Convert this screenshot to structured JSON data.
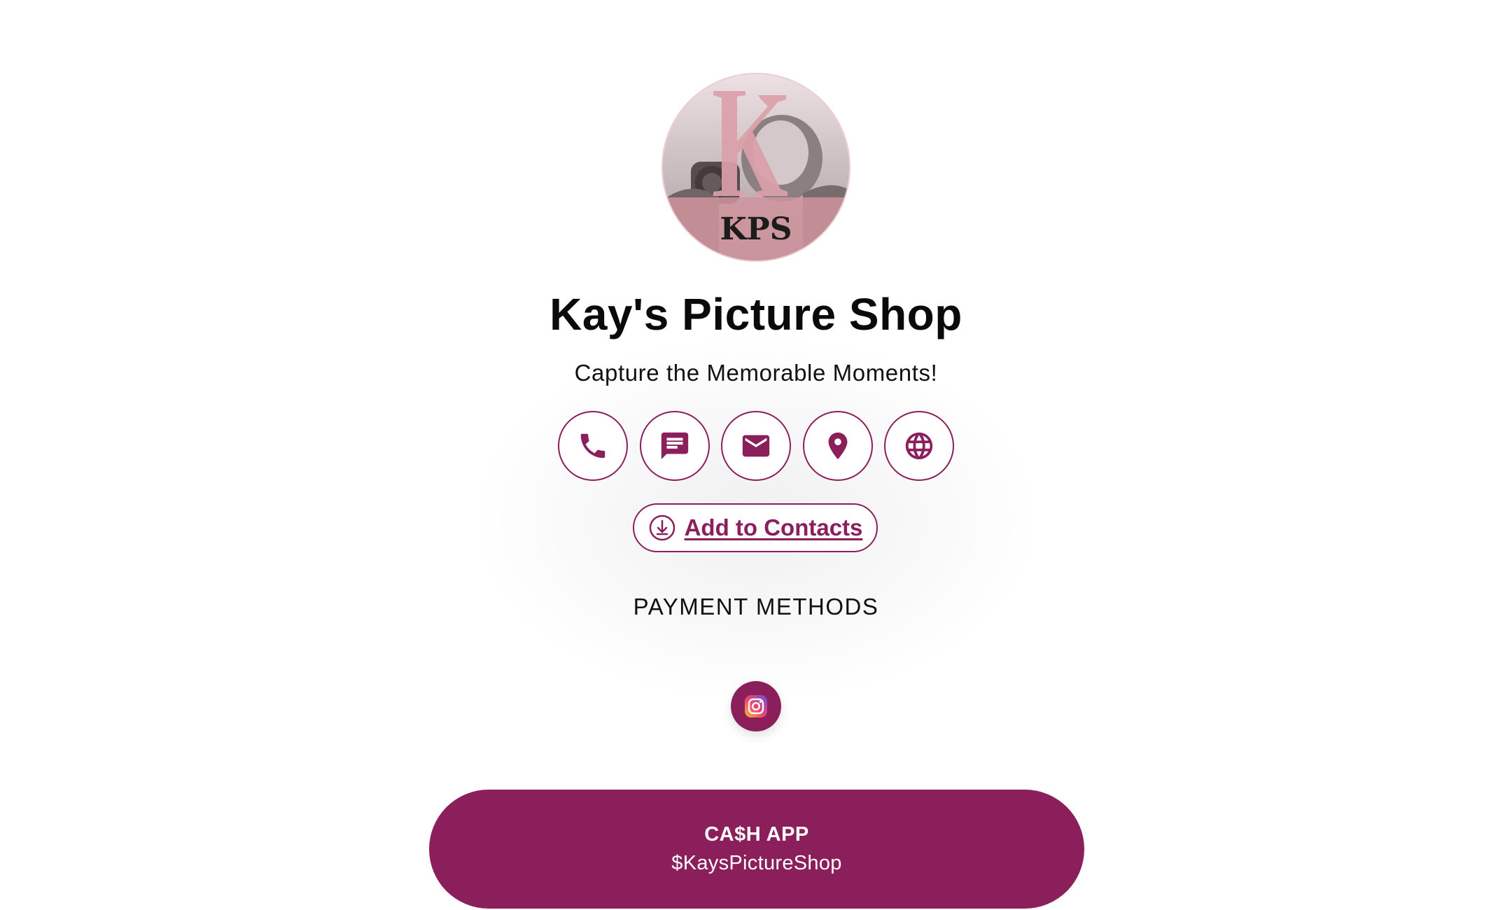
{
  "profile": {
    "avatar_text": "KPS",
    "name": "Kay's Picture Shop",
    "tagline": "Capture the Memorable Moments!"
  },
  "actions": [
    {
      "icon": "phone-icon"
    },
    {
      "icon": "message-icon"
    },
    {
      "icon": "email-icon"
    },
    {
      "icon": "location-pin-icon"
    },
    {
      "icon": "globe-icon"
    }
  ],
  "add_contacts": {
    "label": "Add to Contacts",
    "icon": "download-icon"
  },
  "payments": {
    "heading": "PAYMENT METHODS",
    "items": [
      {
        "name": "CA$H APP",
        "handle": "$KaysPictureShop"
      }
    ]
  },
  "social": {
    "icon": "instagram-icon"
  },
  "colors": {
    "accent": "#8b1f5c",
    "text": "#0a0a0a",
    "background": "#ffffff"
  }
}
